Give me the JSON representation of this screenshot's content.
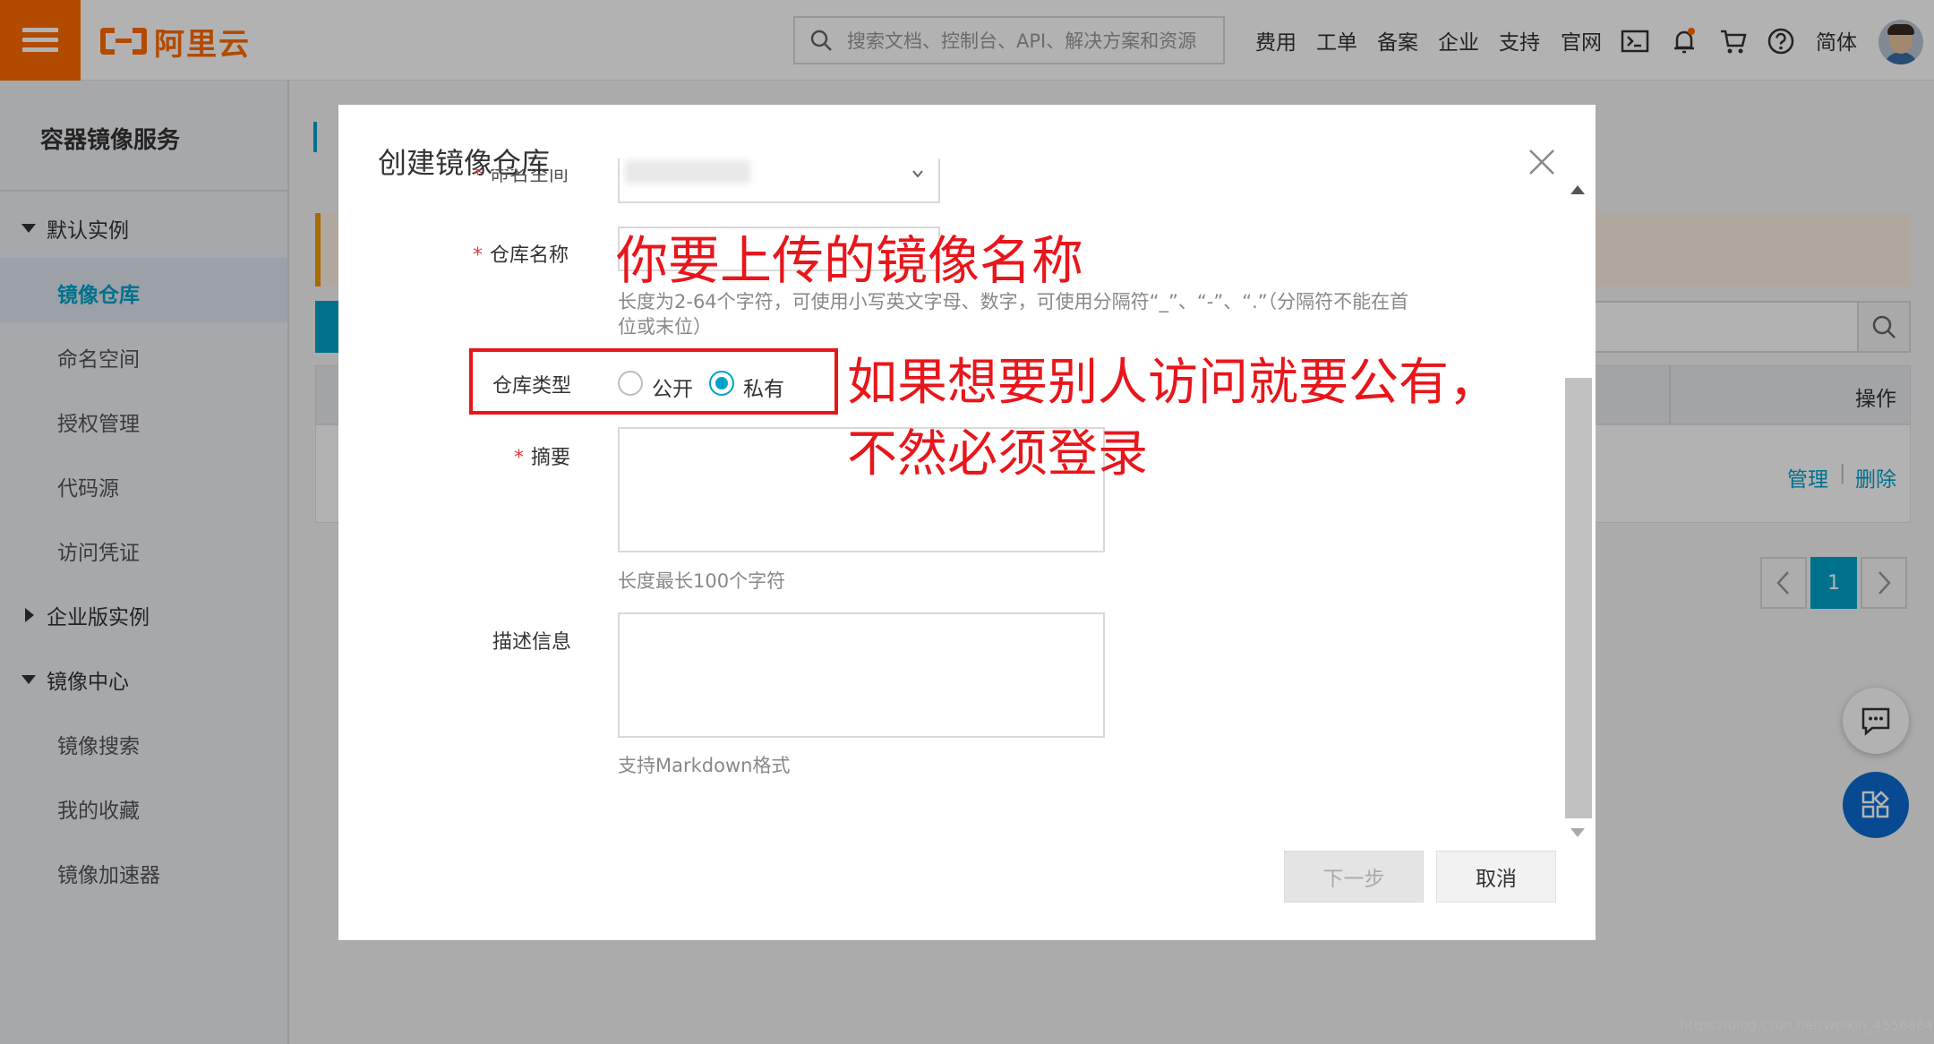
{
  "topbar": {
    "brand": "阿里云",
    "search_placeholder": "搜索文档、控制台、API、解决方案和资源",
    "nav": [
      "费用",
      "工单",
      "备案",
      "企业",
      "支持",
      "官网"
    ],
    "lang": "简体",
    "icons": [
      "menu-icon",
      "search-icon",
      "terminal-icon",
      "bell-icon",
      "cart-icon",
      "help-icon"
    ],
    "accent_color": "#ff6a00"
  },
  "sidebar": {
    "title": "容器镜像服务",
    "groups": [
      {
        "label": "默认实例",
        "expanded": true,
        "items": [
          "镜像仓库",
          "命名空间",
          "授权管理",
          "代码源",
          "访问凭证"
        ]
      },
      {
        "label": "企业版实例",
        "expanded": false,
        "items": []
      },
      {
        "label": "镜像中心",
        "expanded": true,
        "items": [
          "镜像搜索",
          "我的收藏",
          "镜像加速器"
        ]
      }
    ],
    "active_item": "镜像仓库",
    "active_color": "#00a2ca"
  },
  "background": {
    "table_header_op": "操作",
    "row_actions": [
      "管理",
      "删除"
    ],
    "pager_current": "1"
  },
  "modal": {
    "title": "创建镜像仓库",
    "namespace_label": "命名空间",
    "repo_name_label": "仓库名称",
    "repo_name_hint": "长度为2-64个字符，可使用小写英文字母、数字，可使用分隔符“_”、“-”、“.”（分隔符不能在首位或末位）",
    "repo_type_label": "仓库类型",
    "repo_type_options": [
      "公开",
      "私有"
    ],
    "repo_type_selected": "私有",
    "summary_label": "摘要",
    "summary_hint": "长度最长100个字符",
    "description_label": "描述信息",
    "description_hint": "支持Markdown格式",
    "next_button": "下一步",
    "cancel_button": "取消"
  },
  "annotations": {
    "repo_name_note": "你要上传的镜像名称",
    "repo_type_note_line1": "如果想要别人访问就要公有，",
    "repo_type_note_line2": "不然必须登录",
    "color": "#e8161b"
  },
  "watermark": "https://blog.csdn.net/weixin_45568648"
}
